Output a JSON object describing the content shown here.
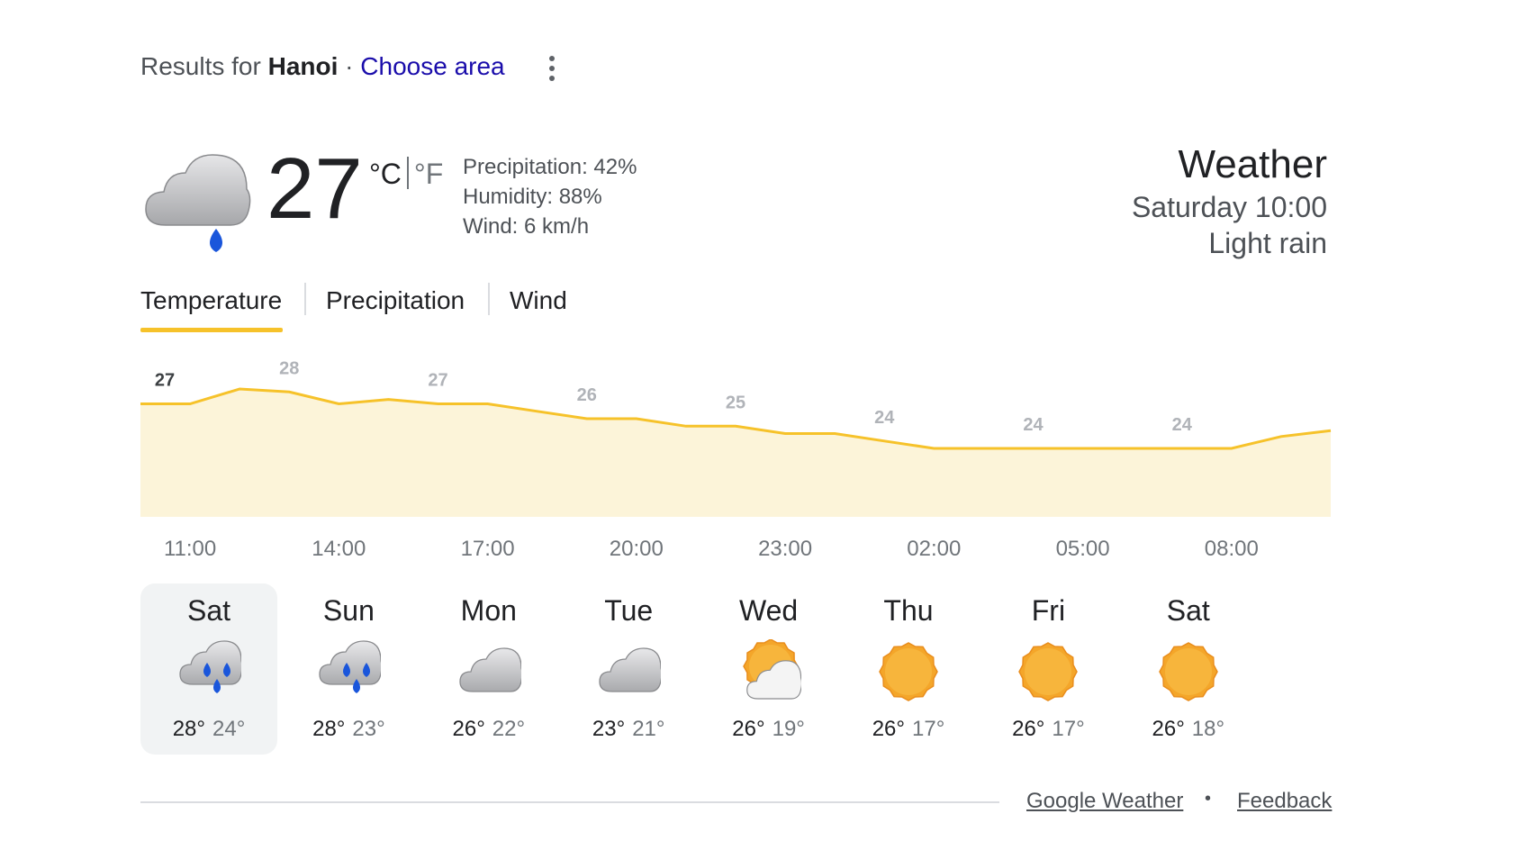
{
  "header": {
    "results_prefix": "Results for",
    "location": "Hanoi",
    "separator": "·",
    "choose_area": "Choose area",
    "more_icon": "more-vert-icon"
  },
  "current": {
    "icon": "rain-icon",
    "temperature": "27",
    "unit_c": "°C",
    "unit_f": "°F",
    "precipitation": "Precipitation: 42%",
    "humidity": "Humidity: 88%",
    "wind": "Wind: 6 km/h",
    "title": "Weather",
    "time": "Saturday 10:00",
    "description": "Light rain"
  },
  "tabs": [
    {
      "label": "Temperature",
      "selected": true
    },
    {
      "label": "Precipitation",
      "selected": false
    },
    {
      "label": "Wind",
      "selected": false
    }
  ],
  "chart_data": {
    "type": "area",
    "x": [
      "10:00",
      "11:00",
      "12:00",
      "13:00",
      "14:00",
      "15:00",
      "16:00",
      "17:00",
      "18:00",
      "19:00",
      "20:00",
      "21:00",
      "22:00",
      "23:00",
      "00:00",
      "01:00",
      "02:00",
      "03:00",
      "04:00",
      "05:00",
      "06:00",
      "07:00",
      "08:00",
      "09:00",
      "10:00"
    ],
    "values": [
      27,
      27,
      28,
      27.8,
      27,
      27.3,
      27,
      27,
      26.5,
      26,
      26,
      25.5,
      25.5,
      25,
      25,
      24.5,
      24,
      24,
      24,
      24,
      24,
      24,
      24,
      24.8,
      25.2
    ],
    "labels": [
      {
        "time": "10:00",
        "text": "27"
      },
      {
        "time": "13:00",
        "text": "28"
      },
      {
        "time": "16:00",
        "text": "27"
      },
      {
        "time": "19:00",
        "text": "26"
      },
      {
        "time": "22:00",
        "text": "25"
      },
      {
        "time": "01:00",
        "text": "24"
      },
      {
        "time": "04:00",
        "text": "24"
      },
      {
        "time": "07:00",
        "text": "24"
      }
    ],
    "x_ticks": [
      "11:00",
      "14:00",
      "17:00",
      "20:00",
      "23:00",
      "02:00",
      "05:00",
      "08:00"
    ],
    "line_color": "#f6c22a",
    "fill_color": "#fcf4d9"
  },
  "days": [
    {
      "name": "Sat",
      "icon": "heavy-rain-icon",
      "high": "28°",
      "low": "24°",
      "selected": true
    },
    {
      "name": "Sun",
      "icon": "heavy-rain-icon",
      "high": "28°",
      "low": "23°",
      "selected": false
    },
    {
      "name": "Mon",
      "icon": "cloudy-icon",
      "high": "26°",
      "low": "22°",
      "selected": false
    },
    {
      "name": "Tue",
      "icon": "cloudy-icon",
      "high": "23°",
      "low": "21°",
      "selected": false
    },
    {
      "name": "Wed",
      "icon": "partly-cloudy-icon",
      "high": "26°",
      "low": "19°",
      "selected": false
    },
    {
      "name": "Thu",
      "icon": "sunny-icon",
      "high": "26°",
      "low": "17°",
      "selected": false
    },
    {
      "name": "Fri",
      "icon": "sunny-icon",
      "high": "26°",
      "low": "17°",
      "selected": false
    },
    {
      "name": "Sat",
      "icon": "sunny-icon",
      "high": "26°",
      "low": "18°",
      "selected": false
    }
  ],
  "footer": {
    "google_weather": "Google Weather",
    "dot": "•",
    "feedback": "Feedback"
  },
  "colors": {
    "accent": "#f6c22a",
    "link": "#1a0dab",
    "rain": "#1a56db",
    "sun": "#f4a62a"
  }
}
